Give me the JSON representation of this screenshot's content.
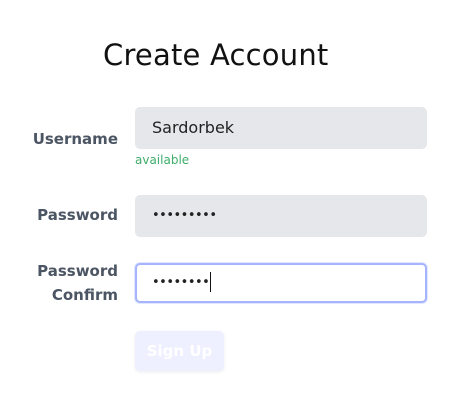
{
  "form": {
    "title": "Create Account",
    "username": {
      "label": "Username",
      "value": "Sardorbek",
      "status": "available"
    },
    "password": {
      "label": "Password",
      "value_masked": "•••••••••"
    },
    "password_confirm": {
      "label_line1": "Password",
      "label_line2": "Confirm",
      "value_masked": "••••••••"
    },
    "submit_label": "Sign Up"
  },
  "colors": {
    "available": "#3fae6b",
    "focus_border": "#a5b4fc",
    "button_bg": "#eef0ff",
    "field_bg": "#e5e7eb"
  }
}
